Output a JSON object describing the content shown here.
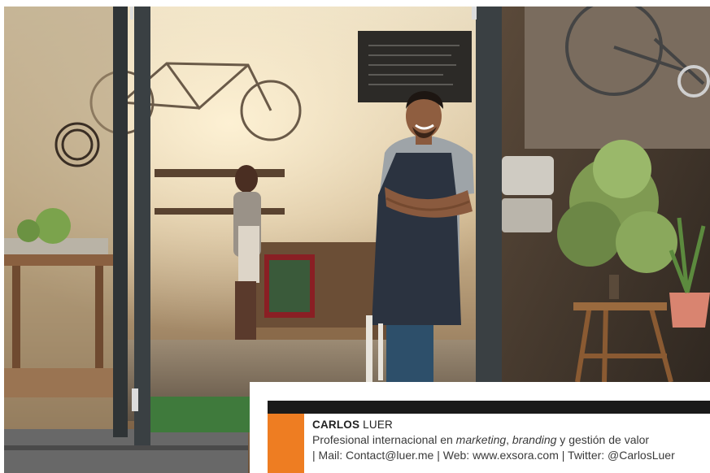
{
  "photo": {
    "alt": "Smiling barista in apron leaning in open glass door of café"
  },
  "caption": {
    "first_name": "CARLOS",
    "last_name": "LUER",
    "subtitle_pre": "Profesional internacional en ",
    "subtitle_em1": "marketing",
    "subtitle_mid": ", ",
    "subtitle_em2": "branding",
    "subtitle_post": " y gestión de valor",
    "contact_line": "| Mail: Contact@luer.me | Web: www.exsora.com | Twitter: @CarlosLuer"
  },
  "colors": {
    "accent": "#ee7d22",
    "bar": "#1a1a1a"
  }
}
